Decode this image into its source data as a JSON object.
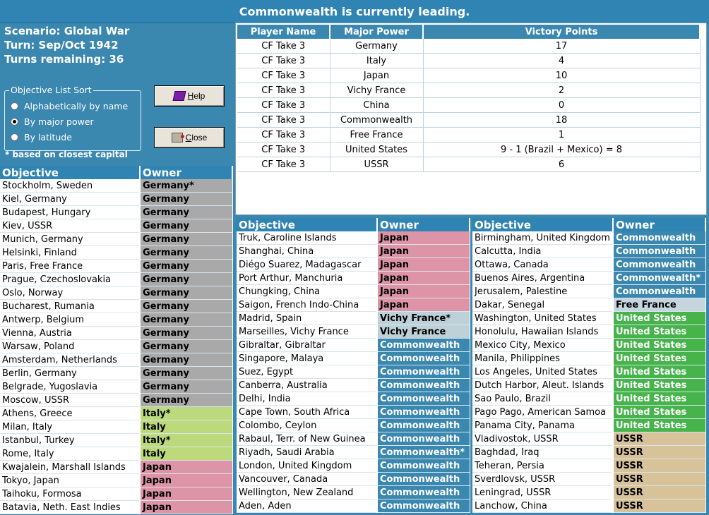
{
  "header": {
    "title": "Commonwealth is currently leading."
  },
  "info": {
    "scenario": "Scenario: Global War",
    "turn": "Turn: Sep/Oct 1942",
    "turns_remaining": "Turns remaining: 36"
  },
  "sort": {
    "legend": "Objective List Sort",
    "options": [
      "Alphabetically by name",
      "By major power",
      "By latitude"
    ],
    "selected": "By major power"
  },
  "buttons": {
    "help": "Help",
    "close": "Close"
  },
  "note": "* based on closest capital",
  "owner_colors": {
    "Germany": "#a9a9a9",
    "Italy": "#bcda7c",
    "Japan": "#dd94a6",
    "Vichy France": "#bed1d9",
    "Commonwealth": "#3a87b0",
    "Free France": "#c6d6de",
    "United States": "#46b44a",
    "USSR": "#d8c29a"
  },
  "vp": {
    "headers": [
      "Player Name",
      "Major Power",
      "Victory Points"
    ],
    "rows": [
      [
        "CF Take 3",
        "Germany",
        "17"
      ],
      [
        "CF Take 3",
        "Italy",
        "4"
      ],
      [
        "CF Take 3",
        "Japan",
        "10"
      ],
      [
        "CF Take 3",
        "Vichy France",
        "2"
      ],
      [
        "CF Take 3",
        "China",
        "0"
      ],
      [
        "CF Take 3",
        "Commonwealth",
        "18"
      ],
      [
        "CF Take 3",
        "Free France",
        "1"
      ],
      [
        "CF Take 3",
        "United States",
        "9 - 1 (Brazil + Mexico) = 8"
      ],
      [
        "CF Take 3",
        "USSR",
        "6"
      ]
    ]
  },
  "objectives": {
    "headers": {
      "objective": "Objective",
      "owner": "Owner"
    },
    "columns": [
      [
        [
          "Stockholm, Sweden",
          "Germany*",
          "Germany"
        ],
        [
          "Kiel, Germany",
          "Germany",
          "Germany"
        ],
        [
          "Budapest, Hungary",
          "Germany",
          "Germany"
        ],
        [
          "Kiev, USSR",
          "Germany",
          "Germany"
        ],
        [
          "Munich, Germany",
          "Germany",
          "Germany"
        ],
        [
          "Helsinki, Finland",
          "Germany",
          "Germany"
        ],
        [
          "Paris, Free France",
          "Germany",
          "Germany"
        ],
        [
          "Prague, Czechoslovakia",
          "Germany",
          "Germany"
        ],
        [
          "Oslo, Norway",
          "Germany",
          "Germany"
        ],
        [
          "Bucharest, Rumania",
          "Germany",
          "Germany"
        ],
        [
          "Antwerp, Belgium",
          "Germany",
          "Germany"
        ],
        [
          "Vienna, Austria",
          "Germany",
          "Germany"
        ],
        [
          "Warsaw, Poland",
          "Germany",
          "Germany"
        ],
        [
          "Amsterdam, Netherlands",
          "Germany",
          "Germany"
        ],
        [
          "Berlin, Germany",
          "Germany",
          "Germany"
        ],
        [
          "Belgrade, Yugoslavia",
          "Germany",
          "Germany"
        ],
        [
          "Moscow, USSR",
          "Germany",
          "Germany"
        ],
        [
          "Athens, Greece",
          "Italy*",
          "Italy"
        ],
        [
          "Milan, Italy",
          "Italy",
          "Italy"
        ],
        [
          "Istanbul, Turkey",
          "Italy*",
          "Italy"
        ],
        [
          "Rome, Italy",
          "Italy",
          "Italy"
        ],
        [
          "Kwajalein, Marshall Islands",
          "Japan",
          "Japan"
        ],
        [
          "Tokyo, Japan",
          "Japan",
          "Japan"
        ],
        [
          "Taihoku, Formosa",
          "Japan",
          "Japan"
        ],
        [
          "Batavia, Neth. East Indies",
          "Japan",
          "Japan"
        ]
      ],
      [
        [
          "Truk, Caroline Islands",
          "Japan",
          "Japan"
        ],
        [
          "Shanghai, China",
          "Japan",
          "Japan"
        ],
        [
          "Diégo Suarez, Madagascar",
          "Japan",
          "Japan"
        ],
        [
          "Port Arthur, Manchuria",
          "Japan",
          "Japan"
        ],
        [
          "Chungking, China",
          "Japan",
          "Japan"
        ],
        [
          "Saigon, French Indo-China",
          "Japan",
          "Japan"
        ],
        [
          "Madrid, Spain",
          "Vichy France*",
          "Vichy France"
        ],
        [
          "Marseilles, Vichy France",
          "Vichy France",
          "Vichy France"
        ],
        [
          "Gibraltar, Gibraltar",
          "Commonwealth",
          "Commonwealth"
        ],
        [
          "Singapore, Malaya",
          "Commonwealth",
          "Commonwealth"
        ],
        [
          "Suez, Egypt",
          "Commonwealth",
          "Commonwealth"
        ],
        [
          "Canberra, Australia",
          "Commonwealth",
          "Commonwealth"
        ],
        [
          "Delhi, India",
          "Commonwealth",
          "Commonwealth"
        ],
        [
          "Cape Town, South Africa",
          "Commonwealth",
          "Commonwealth"
        ],
        [
          "Colombo, Ceylon",
          "Commonwealth",
          "Commonwealth"
        ],
        [
          "Rabaul, Terr. of New Guinea",
          "Commonwealth",
          "Commonwealth"
        ],
        [
          "Riyadh, Saudi Arabia",
          "Commonwealth*",
          "Commonwealth"
        ],
        [
          "London, United Kingdom",
          "Commonwealth",
          "Commonwealth"
        ],
        [
          "Vancouver, Canada",
          "Commonwealth",
          "Commonwealth"
        ],
        [
          "Wellington, New Zealand",
          "Commonwealth",
          "Commonwealth"
        ],
        [
          "Aden, Aden",
          "Commonwealth",
          "Commonwealth"
        ]
      ],
      [
        [
          "Birmingham, United Kingdom",
          "Commonwealth",
          "Commonwealth"
        ],
        [
          "Calcutta, India",
          "Commonwealth",
          "Commonwealth"
        ],
        [
          "Ottawa, Canada",
          "Commonwealth",
          "Commonwealth"
        ],
        [
          "Buenos Aires, Argentina",
          "Commonwealth*",
          "Commonwealth"
        ],
        [
          "Jerusalem, Palestine",
          "Commonwealth",
          "Commonwealth"
        ],
        [
          "Dakar, Senegal",
          "Free France",
          "Free France"
        ],
        [
          "Washington, United States",
          "United States",
          "United States"
        ],
        [
          "Honolulu, Hawaiian Islands",
          "United States",
          "United States"
        ],
        [
          "Mexico City, Mexico",
          "United States",
          "United States"
        ],
        [
          "Manila, Philippines",
          "United States",
          "United States"
        ],
        [
          "Los Angeles, United States",
          "United States",
          "United States"
        ],
        [
          "Dutch Harbor, Aleut. Islands",
          "United States",
          "United States"
        ],
        [
          "Sao Paulo, Brazil",
          "United States",
          "United States"
        ],
        [
          "Pago Pago, American Samoa",
          "United States",
          "United States"
        ],
        [
          "Panama City, Panama",
          "United States",
          "United States"
        ],
        [
          "Vladivostok, USSR",
          "USSR",
          "USSR"
        ],
        [
          "Baghdad, Iraq",
          "USSR",
          "USSR"
        ],
        [
          "Teheran, Persia",
          "USSR",
          "USSR"
        ],
        [
          "Sverdlovsk, USSR",
          "USSR",
          "USSR"
        ],
        [
          "Leningrad, USSR",
          "USSR",
          "USSR"
        ],
        [
          "Lanchow, China",
          "USSR",
          "USSR"
        ]
      ]
    ]
  }
}
